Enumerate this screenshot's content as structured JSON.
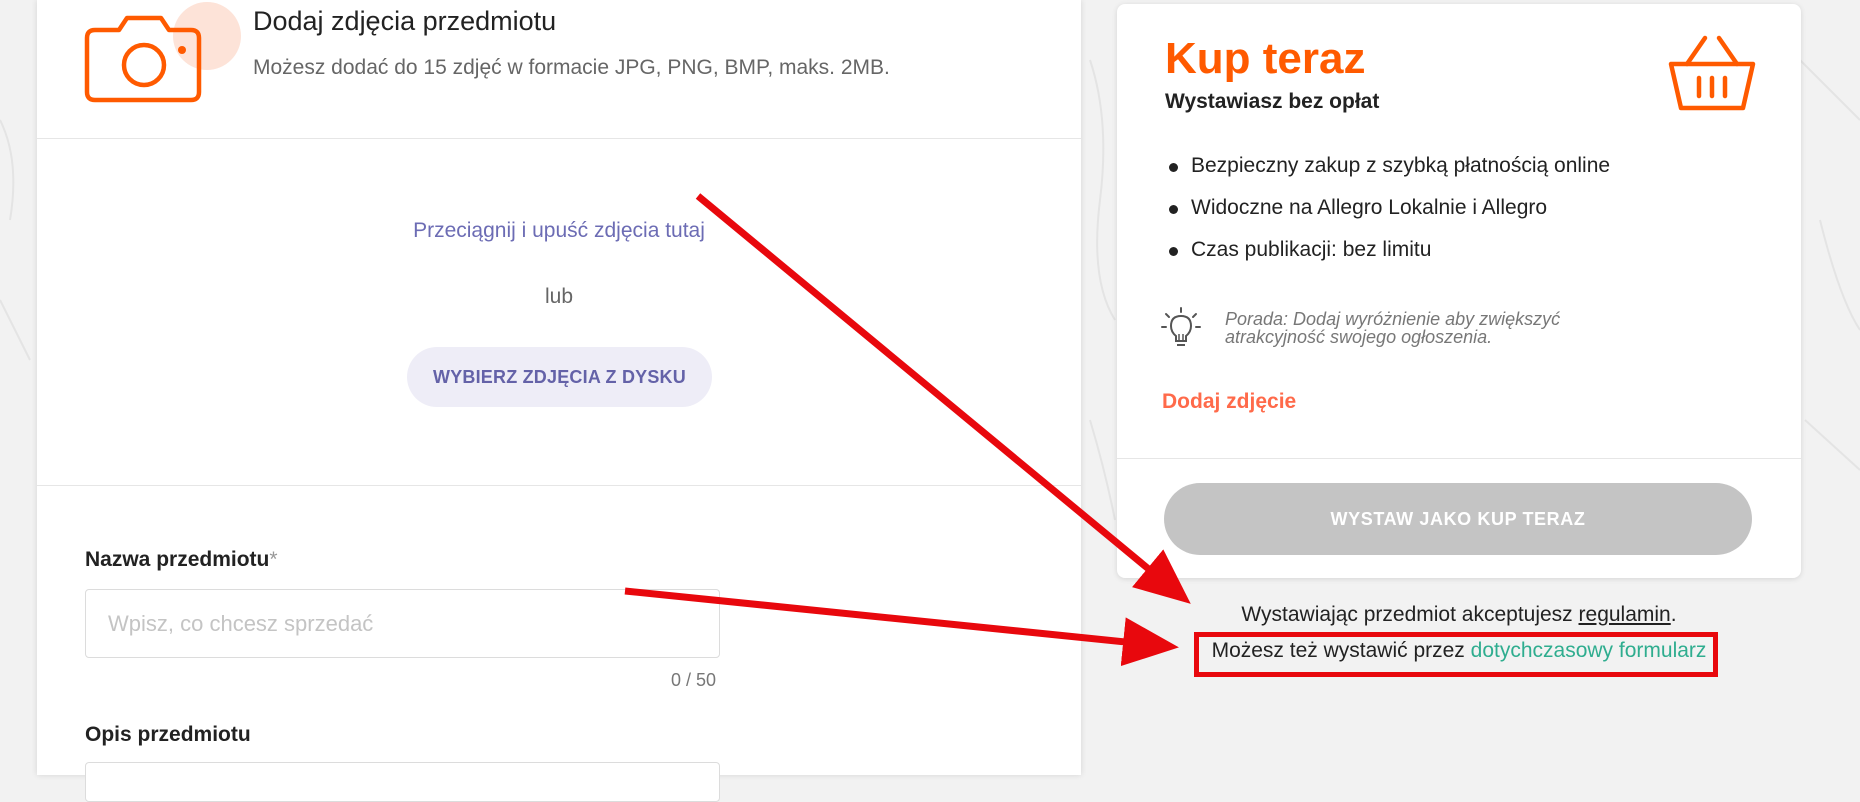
{
  "photos": {
    "title": "Dodaj zdjęcia przedmiotu",
    "subtitle": "Możesz dodać do 15 zdjęć w formacie JPG, PNG, BMP, maks. 2MB.",
    "drop_text": "Przeciągnij i upuść zdjęcia tutaj",
    "or_text": "lub",
    "choose_button": "WYBIERZ ZDJĘCIA Z DYSKU"
  },
  "form": {
    "name_label": "Nazwa przedmiotu",
    "required_mark": "*",
    "name_placeholder": "Wpisz, co chcesz sprzedać",
    "name_value": "",
    "char_counter": "0 / 50",
    "description_label": "Opis przedmiotu"
  },
  "card": {
    "title": "Kup teraz",
    "subtitle": "Wystawiasz bez opłat",
    "features": [
      "Bezpieczny zakup z szybką płatnością online",
      "Widoczne na Allegro Lokalnie i Allegro",
      "Czas publikacji: bez limitu"
    ],
    "tip": "Porada: Dodaj wyróżnienie aby zwiększyć atrakcyjność swojego ogłoszenia.",
    "add_photo_link": "Dodaj zdjęcie",
    "publish_button": "WYSTAW JAKO KUP TERAZ"
  },
  "footer": {
    "terms_prefix": "Wystawiając przedmiot akceptujesz ",
    "terms_link": "regulamin",
    "terms_suffix": ".",
    "old_form_prefix": "Możesz też wystawić przez ",
    "old_form_link": "dotychczasowy formularz"
  },
  "colors": {
    "brand_orange": "#ff5a00",
    "link_teal": "#2fad8f",
    "annotation_red": "#e8080d",
    "accent_purple": "#6c6cb4",
    "disabled_gray": "#c4c4c4"
  },
  "icons": [
    "camera-icon",
    "basket-icon",
    "lightbulb-icon"
  ]
}
